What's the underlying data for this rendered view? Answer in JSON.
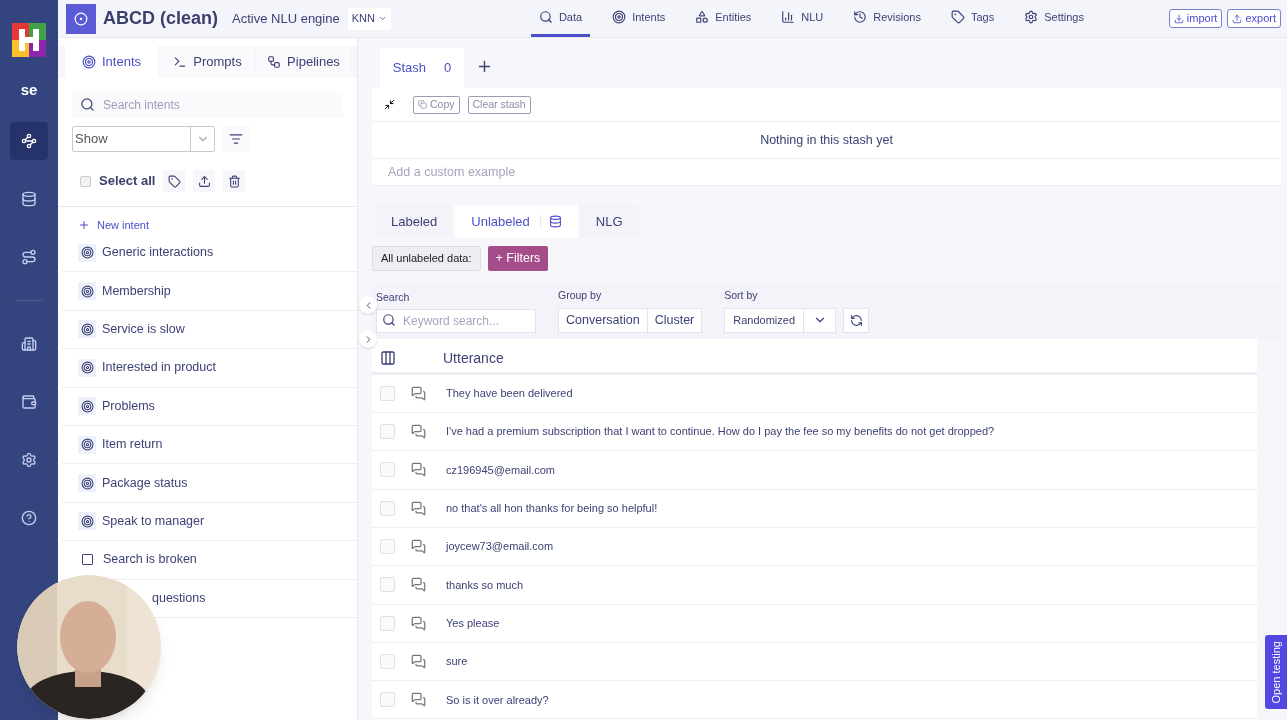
{
  "rail": {
    "badge": "se",
    "items": [
      {
        "selected": true
      },
      {
        "selected": false
      },
      {
        "selected": false
      },
      {
        "selected": false
      },
      {
        "selected": false
      },
      {
        "selected": false
      },
      {
        "selected": false
      }
    ]
  },
  "header": {
    "title": "ABCD (clean)",
    "engine_label": "Active NLU engine",
    "engine": "KNN",
    "nav": [
      {
        "label": "Data",
        "selected": true
      },
      {
        "label": "Intents",
        "selected": false
      },
      {
        "label": "Entities",
        "selected": false
      },
      {
        "label": "NLU",
        "selected": false
      },
      {
        "label": "Revisions",
        "selected": false
      },
      {
        "label": "Tags",
        "selected": false
      },
      {
        "label": "Settings",
        "selected": false
      }
    ],
    "buttons": [
      {
        "label": "import"
      },
      {
        "label": "export"
      }
    ]
  },
  "sidebar": {
    "tabs": [
      {
        "label": "Intents",
        "selected": true
      },
      {
        "label": "Prompts",
        "selected": false
      },
      {
        "label": "Pipelines",
        "selected": false
      }
    ],
    "search": {
      "placeholder": "Search intents"
    },
    "show_select": "Show",
    "select_all": {
      "label": "Select all",
      "checked": false
    },
    "new_intent": "New intent",
    "items": [
      {
        "label": "Generic interactions",
        "kind": "intent"
      },
      {
        "label": "Membership",
        "kind": "intent"
      },
      {
        "label": "Service is slow",
        "kind": "intent"
      },
      {
        "label": "Interested in product",
        "kind": "intent"
      },
      {
        "label": "Problems",
        "kind": "intent"
      },
      {
        "label": "Item return",
        "kind": "intent"
      },
      {
        "label": "Package status",
        "kind": "intent"
      },
      {
        "label": "Speak to manager",
        "kind": "intent"
      },
      {
        "label": "Search is broken",
        "kind": "checkbox"
      },
      {
        "label": "questions",
        "kind": "covered"
      }
    ]
  },
  "stash": {
    "tab": "Stash",
    "count": "0",
    "copy": "Copy",
    "clear": "Clear stash",
    "empty": "Nothing in this stash yet",
    "custom_example": {
      "placeholder": "Add a custom example"
    }
  },
  "data_tabs": [
    {
      "label": "Labeled",
      "selected": false,
      "kind": "plain"
    },
    {
      "label": "Unlabeled",
      "selected": true,
      "kind": "dataset"
    },
    {
      "label": "NLG",
      "selected": false,
      "kind": "plain"
    }
  ],
  "filters": {
    "label": "All unlabeled data:",
    "button": "+ Filters"
  },
  "controls": {
    "search_label": "Search",
    "search": {
      "placeholder": "Keyword search..."
    },
    "group_label": "Group by",
    "group_options": [
      {
        "label": "Conversation"
      },
      {
        "label": "Cluster"
      }
    ],
    "sort_label": "Sort by",
    "sort": "Randomized"
  },
  "table": {
    "column": "Utterance",
    "rows": [
      {
        "text": "They have been delivered",
        "checked": false
      },
      {
        "text": "I've had a premium subscription that I want to continue. How do I pay the fee so my benefits do not get dropped?",
        "checked": false
      },
      {
        "text": "cz196945@email.com",
        "checked": false
      },
      {
        "text": "no that's all hon thanks for being so helpful!",
        "checked": false
      },
      {
        "text": "joycew73@email.com",
        "checked": false
      },
      {
        "text": "thanks so much",
        "checked": false
      },
      {
        "text": "Yes please",
        "checked": false
      },
      {
        "text": "sure",
        "checked": false
      },
      {
        "text": "So is it over already?",
        "checked": false
      }
    ]
  },
  "open_testing": "Open testing"
}
